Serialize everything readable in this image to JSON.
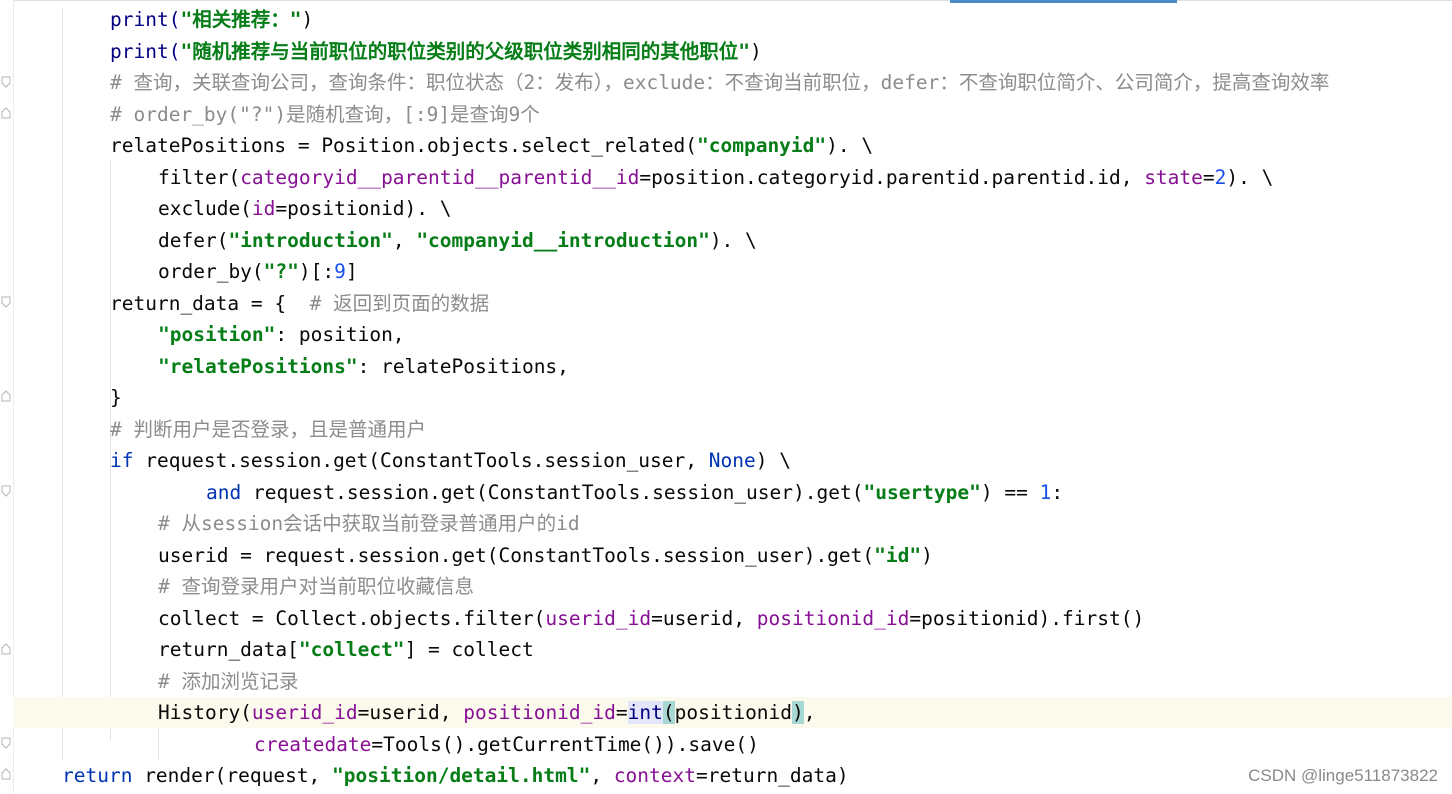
{
  "lines": [
    {
      "indent": 2,
      "tokens": [
        {
          "t": "print(",
          "c": "bi"
        },
        {
          "t": "\"相关推荐：\"",
          "c": "str"
        },
        {
          "t": ")",
          "c": ""
        }
      ]
    },
    {
      "indent": 2,
      "tokens": [
        {
          "t": "print(",
          "c": "bi"
        },
        {
          "t": "\"随机推荐与当前职位的职位类别的父级职位类别相同的其他职位\"",
          "c": "str"
        },
        {
          "t": ")",
          "c": ""
        }
      ]
    },
    {
      "indent": 2,
      "tokens": [
        {
          "t": "# 查询，关联查询公司，查询条件：职位状态（2：发布），exclude：不查询当前职位，defer：不查询职位简介、公司简介，提高查询效率",
          "c": "cm"
        }
      ]
    },
    {
      "indent": 2,
      "tokens": [
        {
          "t": "# order_by(\"?\")是随机查询，[:9]是查询9个",
          "c": "cm"
        }
      ]
    },
    {
      "indent": 2,
      "tokens": [
        {
          "t": "relatePositions = Position.objects.select_related(",
          "c": ""
        },
        {
          "t": "\"companyid\"",
          "c": "str"
        },
        {
          "t": "). \\",
          "c": ""
        }
      ]
    },
    {
      "indent": 3,
      "tokens": [
        {
          "t": "filter(",
          "c": ""
        },
        {
          "t": "categoryid__parentid__parentid__id",
          "c": "param"
        },
        {
          "t": "=position.categoryid.parentid.parentid.id, ",
          "c": ""
        },
        {
          "t": "state",
          "c": "param"
        },
        {
          "t": "=",
          "c": ""
        },
        {
          "t": "2",
          "c": "num"
        },
        {
          "t": "). \\",
          "c": ""
        }
      ]
    },
    {
      "indent": 3,
      "tokens": [
        {
          "t": "exclude(",
          "c": ""
        },
        {
          "t": "id",
          "c": "param"
        },
        {
          "t": "=positionid). \\",
          "c": ""
        }
      ]
    },
    {
      "indent": 3,
      "tokens": [
        {
          "t": "defer(",
          "c": ""
        },
        {
          "t": "\"introduction\"",
          "c": "str"
        },
        {
          "t": ", ",
          "c": ""
        },
        {
          "t": "\"companyid__introduction\"",
          "c": "str"
        },
        {
          "t": "). \\",
          "c": ""
        }
      ]
    },
    {
      "indent": 3,
      "tokens": [
        {
          "t": "order_by(",
          "c": ""
        },
        {
          "t": "\"?\"",
          "c": "str"
        },
        {
          "t": ")[:",
          "c": ""
        },
        {
          "t": "9",
          "c": "num"
        },
        {
          "t": "]",
          "c": ""
        }
      ]
    },
    {
      "indent": 2,
      "tokens": [
        {
          "t": "return_data = {  ",
          "c": ""
        },
        {
          "t": "# 返回到页面的数据",
          "c": "cm"
        }
      ]
    },
    {
      "indent": 3,
      "tokens": [
        {
          "t": "\"position\"",
          "c": "str"
        },
        {
          "t": ": position,",
          "c": ""
        }
      ]
    },
    {
      "indent": 3,
      "tokens": [
        {
          "t": "\"relatePositions\"",
          "c": "str"
        },
        {
          "t": ": relatePositions,",
          "c": ""
        }
      ]
    },
    {
      "indent": 2,
      "tokens": [
        {
          "t": "}",
          "c": ""
        }
      ]
    },
    {
      "indent": 2,
      "tokens": [
        {
          "t": "# 判断用户是否登录，且是普通用户",
          "c": "cm"
        }
      ]
    },
    {
      "indent": 2,
      "tokens": [
        {
          "t": "if",
          "c": "kw"
        },
        {
          "t": " request.session.get(ConstantTools.session_user, ",
          "c": ""
        },
        {
          "t": "None",
          "c": "kw"
        },
        {
          "t": ") \\",
          "c": ""
        }
      ]
    },
    {
      "indent": 4,
      "tokens": [
        {
          "t": "and",
          "c": "kw"
        },
        {
          "t": " request.session.get(ConstantTools.session_user).get(",
          "c": ""
        },
        {
          "t": "\"usertype\"",
          "c": "str"
        },
        {
          "t": ") == ",
          "c": ""
        },
        {
          "t": "1",
          "c": "num"
        },
        {
          "t": ":",
          "c": ""
        }
      ]
    },
    {
      "indent": 3,
      "tokens": [
        {
          "t": "# 从session会话中获取当前登录普通用户的id",
          "c": "cm"
        }
      ]
    },
    {
      "indent": 3,
      "tokens": [
        {
          "t": "userid = request.session.get(ConstantTools.session_user).get(",
          "c": ""
        },
        {
          "t": "\"id\"",
          "c": "str"
        },
        {
          "t": ")",
          "c": ""
        }
      ]
    },
    {
      "indent": 3,
      "tokens": [
        {
          "t": "# 查询登录用户对当前职位收藏信息",
          "c": "cm"
        }
      ]
    },
    {
      "indent": 3,
      "tokens": [
        {
          "t": "collect = Collect.objects.filter(",
          "c": ""
        },
        {
          "t": "userid_id",
          "c": "param"
        },
        {
          "t": "=userid, ",
          "c": ""
        },
        {
          "t": "positionid_id",
          "c": "param"
        },
        {
          "t": "=positionid).first()",
          "c": ""
        }
      ]
    },
    {
      "indent": 3,
      "tokens": [
        {
          "t": "return_data[",
          "c": ""
        },
        {
          "t": "\"collect\"",
          "c": "str"
        },
        {
          "t": "] = collect",
          "c": ""
        }
      ]
    },
    {
      "indent": 3,
      "tokens": [
        {
          "t": "# 添加浏览记录",
          "c": "cm"
        }
      ]
    },
    {
      "indent": 3,
      "current": true,
      "tokens": [
        {
          "t": "History(",
          "c": ""
        },
        {
          "t": "userid_id",
          "c": "param"
        },
        {
          "t": "=userid, ",
          "c": ""
        },
        {
          "t": "positionid_id",
          "c": "param"
        },
        {
          "t": "=",
          "c": ""
        },
        {
          "t": "int",
          "c": "bi bm2"
        },
        {
          "t": "(",
          "c": "bm"
        },
        {
          "t": "positionid",
          "c": ""
        },
        {
          "t": ")",
          "c": "bm"
        },
        {
          "t": ",",
          "c": ""
        }
      ]
    },
    {
      "indent": 5,
      "tokens": [
        {
          "t": "createdate",
          "c": "param"
        },
        {
          "t": "=Tools().getCurrentTime()).save()",
          "c": ""
        }
      ]
    },
    {
      "indent": 1,
      "tokens": [
        {
          "t": "return",
          "c": "kw"
        },
        {
          "t": " render(request, ",
          "c": ""
        },
        {
          "t": "\"position/detail.html\"",
          "c": "str"
        },
        {
          "t": ", ",
          "c": ""
        },
        {
          "t": "context",
          "c": "param"
        },
        {
          "t": "=return_data)",
          "c": ""
        }
      ]
    }
  ],
  "watermark": "CSDN @linge511873822",
  "fold_markers": [
    "fold-open",
    "fold-close",
    "fold-open",
    "fold-close",
    "fold-open",
    "fold-close",
    "fold-open",
    "fold-close"
  ]
}
